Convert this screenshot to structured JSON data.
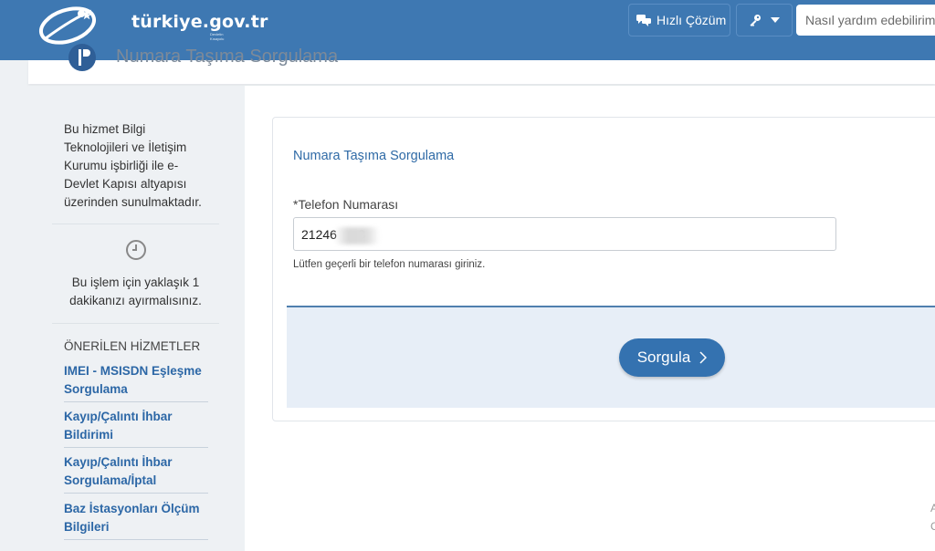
{
  "header": {
    "logo_text": "türkiye.gov.tr",
    "logo_subtext": "Devletin Kısayolu",
    "quick_solution_label": "Hızlı Çözüm",
    "search_placeholder": "Nasıl yardım edebilirim?",
    "colors": {
      "bar": "#3e78b2",
      "accent": "#3472b0"
    }
  },
  "page": {
    "title": "Numara Taşıma Sorgulama"
  },
  "sidebar": {
    "info_text": "Bu hizmet Bilgi Teknolojileri ve İletişim Kurumu işbirliği ile e-Devlet Kapısı altyapısı üzerinden sunulmaktadır.",
    "duration_text": "Bu işlem için yaklaşık 1 dakikanızı ayırmalısınız.",
    "suggested_heading": "ÖNERİLEN HİZMETLER",
    "services": [
      {
        "label": "IMEI - MSISDN Eşleşme Sorgulama"
      },
      {
        "label": "Kayıp/Çalıntı İhbar Bildirimi"
      },
      {
        "label": "Kayıp/Çalıntı İhbar Sorgulama/İptal"
      },
      {
        "label": "Baz İstasyonları Ölçüm Bilgileri"
      }
    ]
  },
  "form": {
    "title": "Numara Taşıma Sorgulama",
    "phone_label": "*Telefon Numarası",
    "phone_value": "21246      3",
    "phone_help": "Lütfen geçerli bir telefon numarası giriniz.",
    "submit_label": "Sorgula"
  },
  "edge": {
    "line1": "A",
    "line2": "C"
  }
}
